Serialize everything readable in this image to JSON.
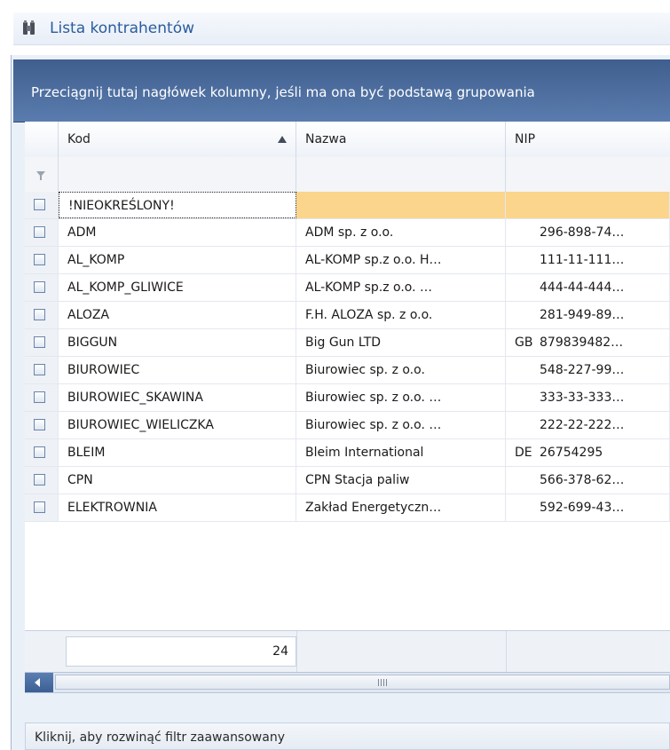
{
  "window": {
    "title": "Lista kontrahentów",
    "icon": "contacts-icon"
  },
  "grid": {
    "group_hint": "Przeciągnij tutaj nagłówek kolumny, jeśli ma ona być podstawą grupowania",
    "columns": {
      "kod": "Kod",
      "nazwa": "Nazwa",
      "nip": "NIP"
    },
    "sort": {
      "column": "Kod",
      "direction": "ascending"
    },
    "rows": [
      {
        "kod": "!NIEOKREŚLONY!",
        "nazwa": "",
        "kraj": "",
        "nip": ""
      },
      {
        "kod": "ADM",
        "nazwa": "ADM sp. z o.o.",
        "kraj": "",
        "nip": "296-898-74…"
      },
      {
        "kod": "AL_KOMP",
        "nazwa": "AL-KOMP sp.z o.o. H…",
        "kraj": "",
        "nip": "111-11-111…"
      },
      {
        "kod": "AL_KOMP_GLIWICE",
        "nazwa": "AL-KOMP sp.z o.o. …",
        "kraj": "",
        "nip": "444-44-444…"
      },
      {
        "kod": "ALOZA",
        "nazwa": "F.H. ALOZA sp. z o.o.",
        "kraj": "",
        "nip": "281-949-89…"
      },
      {
        "kod": "BIGGUN",
        "nazwa": "Big Gun LTD",
        "kraj": "GB",
        "nip": "879839482…"
      },
      {
        "kod": "BIUROWIEC",
        "nazwa": "Biurowiec sp. z o.o.",
        "kraj": "",
        "nip": "548-227-99…"
      },
      {
        "kod": "BIUROWIEC_SKAWINA",
        "nazwa": "Biurowiec sp. z o.o. …",
        "kraj": "",
        "nip": "333-33-333…"
      },
      {
        "kod": "BIUROWIEC_WIELICZKA",
        "nazwa": "Biurowiec sp. z o.o. …",
        "kraj": "",
        "nip": "222-22-222…"
      },
      {
        "kod": "BLEIM",
        "nazwa": "Bleim International",
        "kraj": "DE",
        "nip": "26754295"
      },
      {
        "kod": "CPN",
        "nazwa": "CPN Stacja paliw",
        "kraj": "",
        "nip": "566-378-62…"
      },
      {
        "kod": "ELEKTROWNIA",
        "nazwa": "Zakład Energetyczn…",
        "kraj": "",
        "nip": "592-699-43…"
      }
    ],
    "summary_count": "24"
  },
  "advanced_filter": {
    "label": "Kliknij, aby rozwinąć filtr zaawansowany"
  },
  "colors": {
    "group_panel": "#4a6c9e",
    "selected_row": "#fbd58b",
    "title_text": "#2a5c9c"
  }
}
